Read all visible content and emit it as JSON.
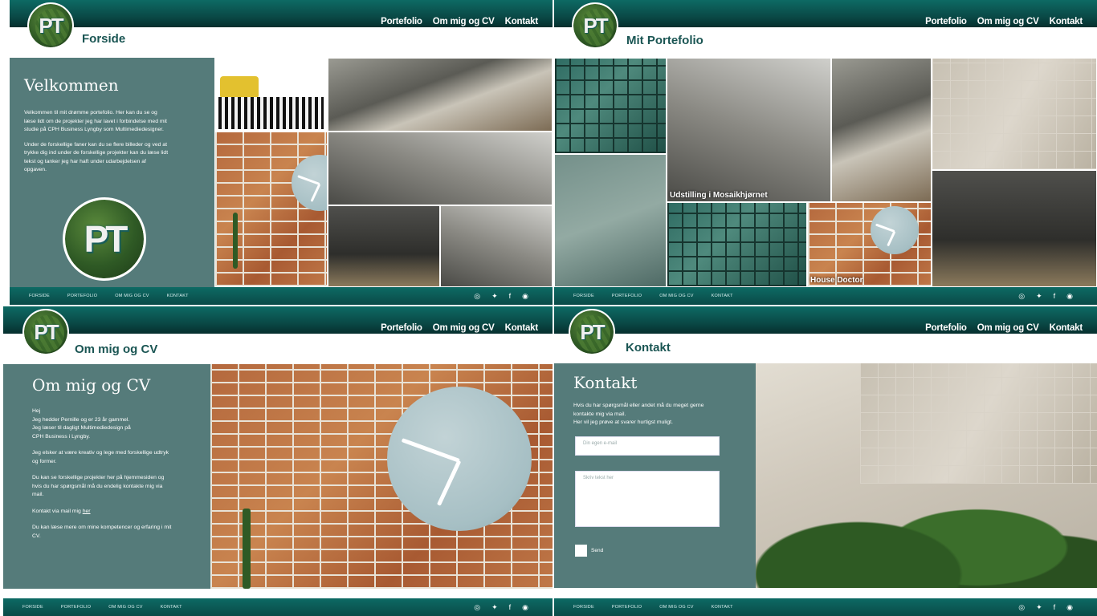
{
  "logo": {
    "monogram": "PT"
  },
  "nav": [
    "Portefolio",
    "Om mig og CV",
    "Kontakt"
  ],
  "footer": {
    "links": [
      "FORSIDE",
      "PORTEFOLIO",
      "OM MIG OG CV",
      "KONTAKT"
    ],
    "icons": [
      "instagram-icon",
      "twitter-icon",
      "facebook-icon",
      "globe-icon"
    ]
  },
  "forside": {
    "title": "Forside",
    "heading": "Velkommen",
    "p1": "Velkommen til mit drømme portefolio. Her kan du se og læse lidt om de projekter jeg har lavet i forbindelse med mit studie på CPH Business Lyngby som Multimediedesigner.",
    "p2": "Under de forskellige faner kan du se flere billeder og ved at trykke dig ind under de forskellige projekter kan du læse lidt tekst og tanker jeg har haft under udarbejdelsen af opgaven."
  },
  "portefolio": {
    "title": "Mit Portefolio",
    "caption1": "Udstilling i Mosaikhjørnet",
    "caption2": "House Doctor"
  },
  "omig": {
    "title": "Om mig og CV",
    "heading": "Om mig og CV",
    "p1": "Hej",
    "p2": "Jeg hedder Pernille og er 23 år gammel.",
    "p3": "Jeg læser til dagligt Multimediedesign på",
    "p4": "CPH Business i Lyngby.",
    "p5": "Jeg  elsker at være kreativ og lege med forskellige udtryk og former.",
    "p6": "Du kan se forskellige projekter her på hjemmesiden og hvis du har spørgsmål må du endelig kontakte mig via mail.",
    "p7": "Kontakt via mail mig ",
    "p7_link": "her",
    "p8": "Du kan læse mere om mine kompetencer og erfaring i mit CV."
  },
  "kontakt": {
    "title": "Kontakt",
    "heading": "Kontakt",
    "p1": "Hvis du har spørgsmål eller andet må du meget gerne kontakte mig via mail.",
    "p2": "Her vil jeg prøve at svarer hurtigst muligt.",
    "email_placeholder": "Din egen e-mail",
    "text_placeholder": "Skriv tekst her",
    "send_label": "Send"
  }
}
